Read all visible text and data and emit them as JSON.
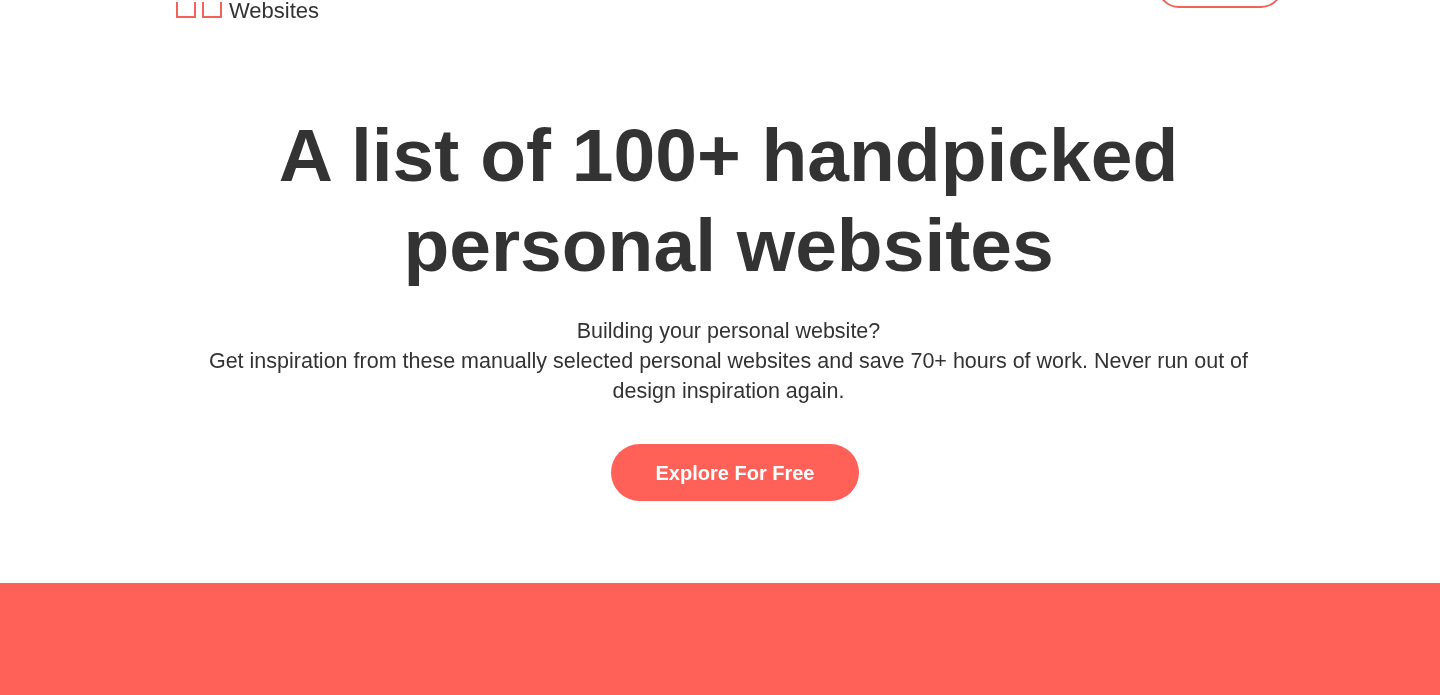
{
  "header": {
    "logo": {
      "text": "Websites"
    }
  },
  "hero": {
    "title": "A list of 100+ handpicked personal websites",
    "lead": "Building your personal website?",
    "description": "Get inspiration from these manually selected personal websites and save 70+ hours of work. Never run out of design inspiration again.",
    "cta": {
      "label": "Explore For Free"
    }
  }
}
